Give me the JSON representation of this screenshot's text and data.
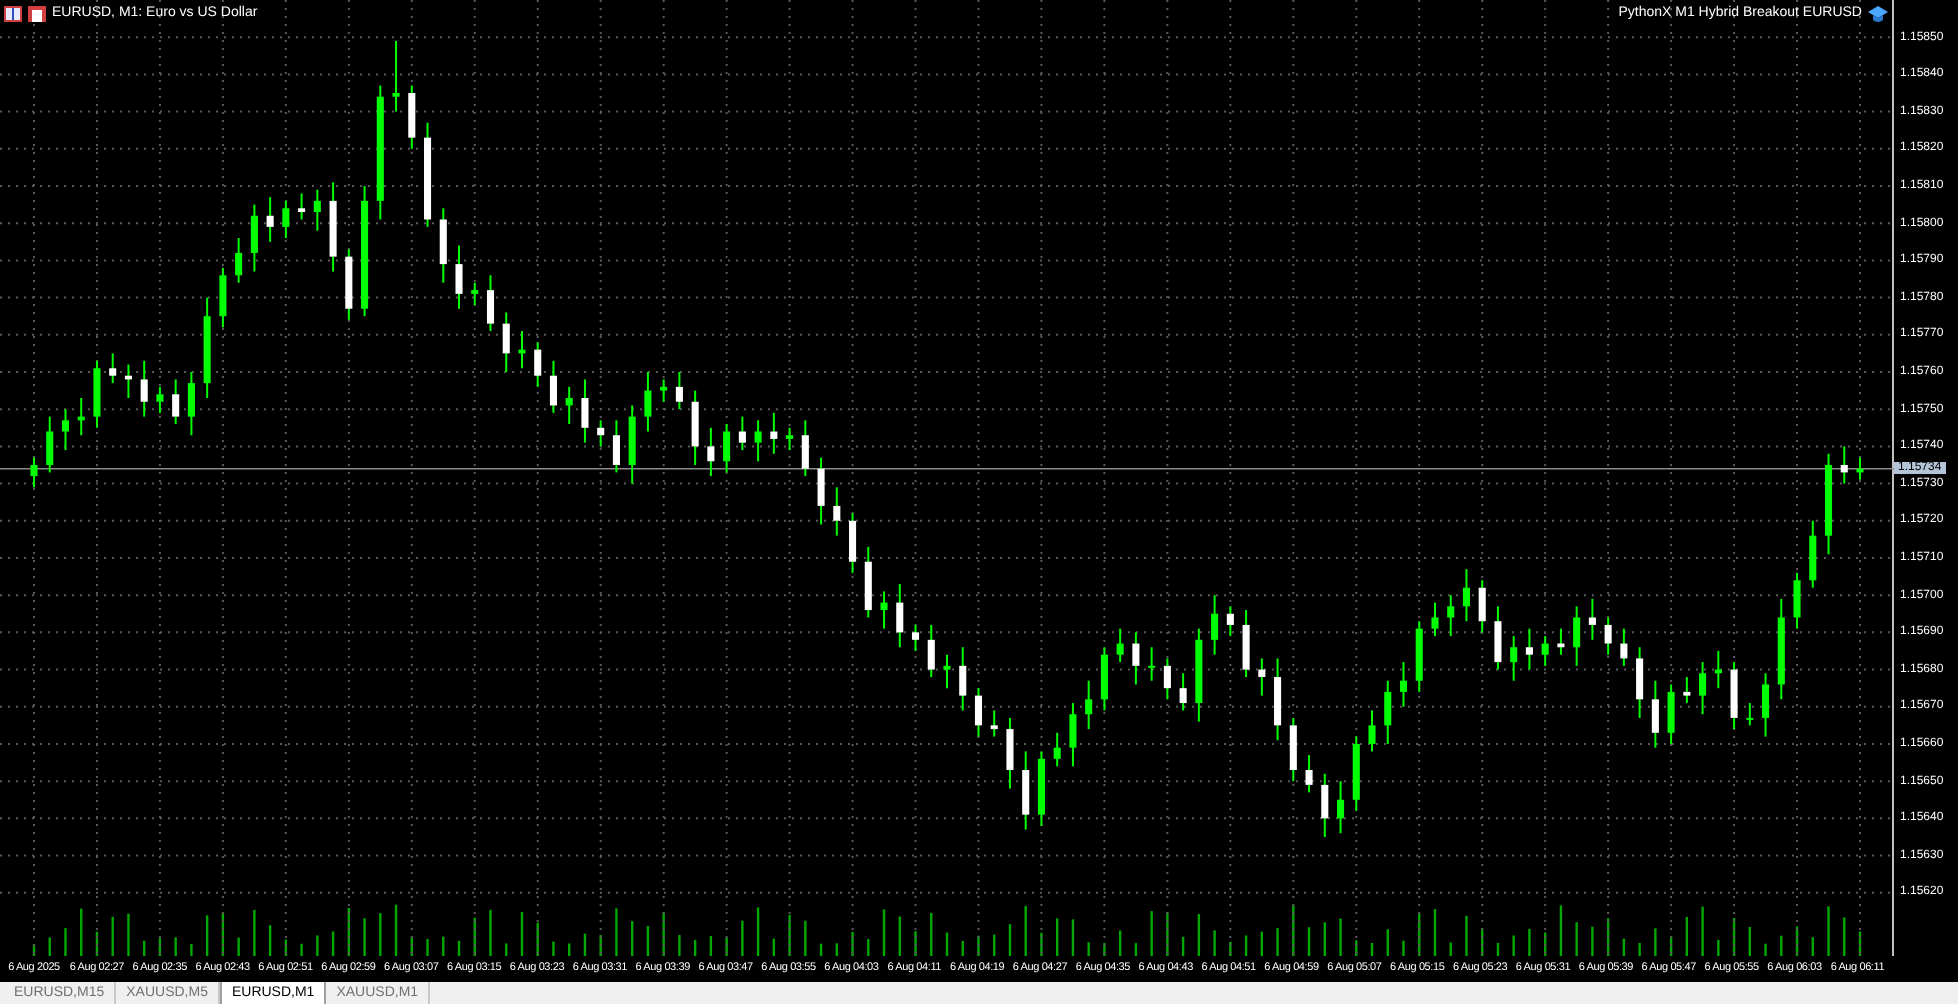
{
  "chart": {
    "symbol_title": "EURUSD, M1:  Euro vs US Dollar",
    "expert_title": "PythonX M1 Hybrid Breakout EURUSD",
    "chart_data": {
      "type": "candlestick",
      "grid": true,
      "ref_lines": [
        {
          "axis": "y",
          "value": 1.15734,
          "label": "1.15734"
        }
      ],
      "ylim": [
        1.15603,
        1.1586
      ],
      "categories": [
        "6 Aug 2025",
        null,
        null,
        null,
        "6 Aug 02:27",
        null,
        null,
        null,
        "6 Aug 02:35",
        null,
        null,
        null,
        "6 Aug 02:43",
        null,
        null,
        null,
        "6 Aug 02:51",
        null,
        null,
        null,
        "6 Aug 02:59",
        null,
        null,
        null,
        "6 Aug 03:07",
        null,
        null,
        null,
        "6 Aug 03:15",
        null,
        null,
        null,
        "6 Aug 03:23",
        null,
        null,
        null,
        "6 Aug 03:31",
        null,
        null,
        null,
        "6 Aug 03:39",
        null,
        null,
        null,
        "6 Aug 03:47",
        null,
        null,
        null,
        "6 Aug 03:55",
        null,
        null,
        null,
        "6 Aug 04:03",
        null,
        null,
        null,
        "6 Aug 04:11",
        null,
        null,
        null,
        "6 Aug 04:19",
        null,
        null,
        null,
        "6 Aug 04:27",
        null,
        null,
        null,
        "6 Aug 04:35",
        null,
        null,
        null,
        "6 Aug 04:43",
        null,
        null,
        null,
        "6 Aug 04:51",
        null,
        null,
        null,
        "6 Aug 04:59",
        null,
        null,
        null,
        "6 Aug 05:07",
        null,
        null,
        null,
        "6 Aug 05:15",
        null,
        null,
        null,
        "6 Aug 05:23",
        null,
        null,
        null,
        "6 Aug 05:31",
        null,
        null,
        null,
        "6 Aug 05:39",
        null,
        null,
        null,
        "6 Aug 05:47",
        null,
        null,
        null,
        "6 Aug 05:55",
        null,
        null,
        null,
        "6 Aug 06:03",
        null,
        null,
        null,
        "6 Aug 06:11"
      ],
      "yticks": [
        {
          "value": 1.1585,
          "label": "1.15850"
        },
        {
          "value": 1.1584,
          "label": "1.15840"
        },
        {
          "value": 1.1583,
          "label": "1.15830"
        },
        {
          "value": 1.1582,
          "label": "1.15820"
        },
        {
          "value": 1.1581,
          "label": "1.15810"
        },
        {
          "value": 1.158,
          "label": "1.15800"
        },
        {
          "value": 1.1579,
          "label": "1.15790"
        },
        {
          "value": 1.1578,
          "label": "1.15780"
        },
        {
          "value": 1.1577,
          "label": "1.15770"
        },
        {
          "value": 1.1576,
          "label": "1.15760"
        },
        {
          "value": 1.1575,
          "label": "1.15750"
        },
        {
          "value": 1.1574,
          "label": "1.15740"
        },
        {
          "value": 1.1573,
          "label": "1.15730"
        },
        {
          "value": 1.1572,
          "label": "1.15720"
        },
        {
          "value": 1.1571,
          "label": "1.15710"
        },
        {
          "value": 1.157,
          "label": "1.15700"
        },
        {
          "value": 1.1569,
          "label": "1.15690"
        },
        {
          "value": 1.1568,
          "label": "1.15680"
        },
        {
          "value": 1.1567,
          "label": "1.15670"
        },
        {
          "value": 1.1566,
          "label": "1.15660"
        },
        {
          "value": 1.1565,
          "label": "1.15650"
        },
        {
          "value": 1.1564,
          "label": "1.15640"
        },
        {
          "value": 1.1563,
          "label": "1.15630"
        },
        {
          "value": 1.1562,
          "label": "1.15620"
        }
      ],
      "ohlc": [
        [
          1.15732,
          1.15737,
          1.15729,
          1.15735
        ],
        [
          1.15735,
          1.15748,
          1.15733,
          1.15744
        ],
        [
          1.15744,
          1.1575,
          1.15739,
          1.15747
        ],
        [
          1.15747,
          1.15753,
          1.15743,
          1.15748
        ],
        [
          1.15748,
          1.15763,
          1.15745,
          1.15761
        ],
        [
          1.15761,
          1.15765,
          1.15757,
          1.15759
        ],
        [
          1.15759,
          1.15762,
          1.15753,
          1.15758
        ],
        [
          1.15758,
          1.15763,
          1.15748,
          1.15752
        ],
        [
          1.15752,
          1.15756,
          1.15749,
          1.15754
        ],
        [
          1.15754,
          1.15758,
          1.15746,
          1.15748
        ],
        [
          1.15748,
          1.1576,
          1.15743,
          1.15757
        ],
        [
          1.15757,
          1.1578,
          1.15753,
          1.15775
        ],
        [
          1.15775,
          1.15788,
          1.15772,
          1.15786
        ],
        [
          1.15786,
          1.15796,
          1.15784,
          1.15792
        ],
        [
          1.15792,
          1.15805,
          1.15787,
          1.15802
        ],
        [
          1.15802,
          1.15807,
          1.15795,
          1.15799
        ],
        [
          1.15799,
          1.15806,
          1.15796,
          1.15804
        ],
        [
          1.15804,
          1.15808,
          1.15801,
          1.15803
        ],
        [
          1.15803,
          1.15809,
          1.15798,
          1.15806
        ],
        [
          1.15806,
          1.15811,
          1.15787,
          1.15791
        ],
        [
          1.15791,
          1.15793,
          1.15774,
          1.15777
        ],
        [
          1.15777,
          1.1581,
          1.15775,
          1.15806
        ],
        [
          1.15806,
          1.15837,
          1.15801,
          1.15834
        ],
        [
          1.15834,
          1.15849,
          1.1583,
          1.15835
        ],
        [
          1.15835,
          1.15837,
          1.1582,
          1.15823
        ],
        [
          1.15823,
          1.15827,
          1.15799,
          1.15801
        ],
        [
          1.15801,
          1.15804,
          1.15784,
          1.15789
        ],
        [
          1.15789,
          1.15794,
          1.15777,
          1.15781
        ],
        [
          1.15781,
          1.15784,
          1.15778,
          1.15782
        ],
        [
          1.15782,
          1.15786,
          1.15771,
          1.15773
        ],
        [
          1.15773,
          1.15776,
          1.1576,
          1.15765
        ],
        [
          1.15765,
          1.15771,
          1.15761,
          1.15766
        ],
        [
          1.15766,
          1.15768,
          1.15756,
          1.15759
        ],
        [
          1.15759,
          1.15763,
          1.15749,
          1.15751
        ],
        [
          1.15751,
          1.15756,
          1.15746,
          1.15753
        ],
        [
          1.15753,
          1.15758,
          1.15741,
          1.15745
        ],
        [
          1.15745,
          1.15747,
          1.1574,
          1.15743
        ],
        [
          1.15743,
          1.15747,
          1.15733,
          1.15735
        ],
        [
          1.15735,
          1.15751,
          1.1573,
          1.15748
        ],
        [
          1.15748,
          1.1576,
          1.15744,
          1.15755
        ],
        [
          1.15755,
          1.15758,
          1.15752,
          1.15756
        ],
        [
          1.15756,
          1.1576,
          1.1575,
          1.15752
        ],
        [
          1.15752,
          1.15755,
          1.15735,
          1.1574
        ],
        [
          1.1574,
          1.15745,
          1.15732,
          1.15736
        ],
        [
          1.15736,
          1.15746,
          1.15733,
          1.15744
        ],
        [
          1.15744,
          1.15748,
          1.15739,
          1.15741
        ],
        [
          1.15741,
          1.15747,
          1.15736,
          1.15744
        ],
        [
          1.15744,
          1.15749,
          1.15738,
          1.15742
        ],
        [
          1.15742,
          1.15745,
          1.15739,
          1.15743
        ],
        [
          1.15743,
          1.15747,
          1.15732,
          1.15734
        ],
        [
          1.15734,
          1.15737,
          1.15719,
          1.15724
        ],
        [
          1.15724,
          1.15729,
          1.15716,
          1.1572
        ],
        [
          1.1572,
          1.15722,
          1.15706,
          1.15709
        ],
        [
          1.15709,
          1.15713,
          1.15694,
          1.15696
        ],
        [
          1.15696,
          1.15701,
          1.15691,
          1.15698
        ],
        [
          1.15698,
          1.15703,
          1.15686,
          1.1569
        ],
        [
          1.1569,
          1.15692,
          1.15685,
          1.15688
        ],
        [
          1.15688,
          1.15692,
          1.15678,
          1.1568
        ],
        [
          1.1568,
          1.15684,
          1.15675,
          1.15681
        ],
        [
          1.15681,
          1.15686,
          1.15669,
          1.15673
        ],
        [
          1.15673,
          1.15675,
          1.15662,
          1.15665
        ],
        [
          1.15665,
          1.15669,
          1.15662,
          1.15664
        ],
        [
          1.15664,
          1.15667,
          1.15648,
          1.15653
        ],
        [
          1.15653,
          1.15658,
          1.15637,
          1.15641
        ],
        [
          1.15641,
          1.15658,
          1.15638,
          1.15656
        ],
        [
          1.15656,
          1.15663,
          1.15654,
          1.15659
        ],
        [
          1.15659,
          1.15671,
          1.15654,
          1.15668
        ],
        [
          1.15668,
          1.15677,
          1.15664,
          1.15672
        ],
        [
          1.15672,
          1.15686,
          1.15669,
          1.15684
        ],
        [
          1.15684,
          1.15691,
          1.15682,
          1.15687
        ],
        [
          1.15687,
          1.1569,
          1.15676,
          1.15681
        ],
        [
          1.15681,
          1.15686,
          1.15677,
          1.15681
        ],
        [
          1.15681,
          1.15683,
          1.15672,
          1.15675
        ],
        [
          1.15675,
          1.15679,
          1.15669,
          1.15671
        ],
        [
          1.15671,
          1.15691,
          1.15666,
          1.15688
        ],
        [
          1.15688,
          1.157,
          1.15684,
          1.15695
        ],
        [
          1.15695,
          1.15697,
          1.15689,
          1.15692
        ],
        [
          1.15692,
          1.15696,
          1.15678,
          1.1568
        ],
        [
          1.1568,
          1.15683,
          1.15673,
          1.15678
        ],
        [
          1.15678,
          1.15683,
          1.15661,
          1.15665
        ],
        [
          1.15665,
          1.15667,
          1.1565,
          1.15653
        ],
        [
          1.15653,
          1.15657,
          1.15647,
          1.15649
        ],
        [
          1.15649,
          1.15652,
          1.15635,
          1.1564
        ],
        [
          1.1564,
          1.1565,
          1.15636,
          1.15645
        ],
        [
          1.15645,
          1.15662,
          1.15642,
          1.1566
        ],
        [
          1.1566,
          1.15669,
          1.15658,
          1.15665
        ],
        [
          1.15665,
          1.15677,
          1.1566,
          1.15674
        ],
        [
          1.15674,
          1.15682,
          1.1567,
          1.15677
        ],
        [
          1.15677,
          1.15693,
          1.15674,
          1.15691
        ],
        [
          1.15691,
          1.15698,
          1.15689,
          1.15694
        ],
        [
          1.15694,
          1.157,
          1.15689,
          1.15697
        ],
        [
          1.15697,
          1.15707,
          1.15693,
          1.15702
        ],
        [
          1.15702,
          1.15704,
          1.1569,
          1.15693
        ],
        [
          1.15693,
          1.15697,
          1.1568,
          1.15682
        ],
        [
          1.15682,
          1.15689,
          1.15677,
          1.15686
        ],
        [
          1.15686,
          1.15691,
          1.1568,
          1.15684
        ],
        [
          1.15684,
          1.15689,
          1.15681,
          1.15687
        ],
        [
          1.15687,
          1.15691,
          1.15684,
          1.15686
        ],
        [
          1.15686,
          1.15697,
          1.15681,
          1.15694
        ],
        [
          1.15694,
          1.15699,
          1.15688,
          1.15692
        ],
        [
          1.15692,
          1.15694,
          1.15684,
          1.15687
        ],
        [
          1.15687,
          1.15691,
          1.15681,
          1.15683
        ],
        [
          1.15683,
          1.15686,
          1.15667,
          1.15672
        ],
        [
          1.15672,
          1.15677,
          1.15659,
          1.15663
        ],
        [
          1.15663,
          1.15676,
          1.1566,
          1.15674
        ],
        [
          1.15674,
          1.15678,
          1.15671,
          1.15673
        ],
        [
          1.15673,
          1.15682,
          1.15668,
          1.15679
        ],
        [
          1.15679,
          1.15685,
          1.15675,
          1.1568
        ],
        [
          1.1568,
          1.15682,
          1.15664,
          1.15667
        ],
        [
          1.15667,
          1.15671,
          1.15665,
          1.15667
        ],
        [
          1.15667,
          1.15679,
          1.15662,
          1.15676
        ],
        [
          1.15676,
          1.15699,
          1.15672,
          1.15694
        ],
        [
          1.15694,
          1.15706,
          1.15691,
          1.15704
        ],
        [
          1.15704,
          1.1572,
          1.15702,
          1.15716
        ],
        [
          1.15716,
          1.15738,
          1.15711,
          1.15735
        ],
        [
          1.15735,
          1.1574,
          1.1573,
          1.15733
        ],
        [
          1.15733,
          1.15737,
          1.15731,
          1.15734
        ]
      ]
    }
  },
  "tabs": [
    {
      "label": "EURUSD,M15",
      "selected": false
    },
    {
      "label": "XAUUSD,M5",
      "selected": false
    },
    {
      "label": "EURUSD,M1",
      "selected": true
    },
    {
      "label": "XAUUSD,M1",
      "selected": false
    }
  ]
}
